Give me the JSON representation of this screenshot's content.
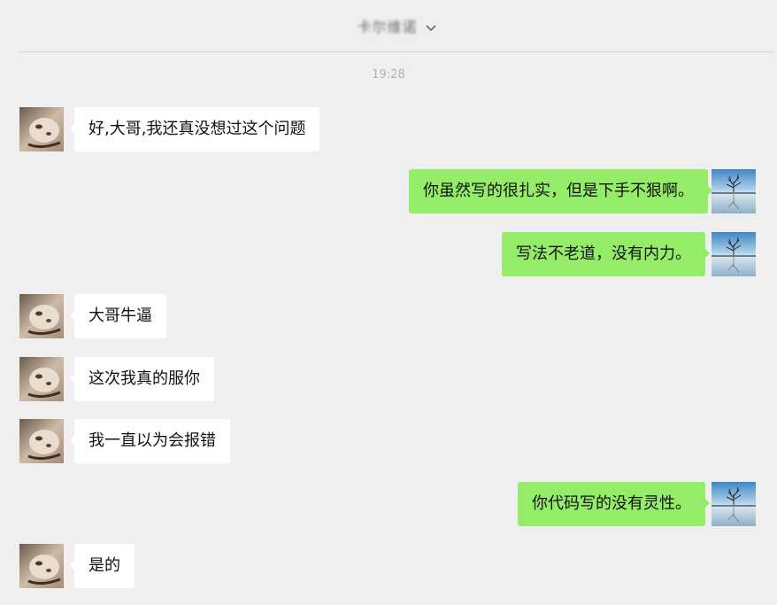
{
  "header": {
    "title": "卡尔维诺"
  },
  "timestamp": "19:28",
  "messages": [
    {
      "side": "left",
      "text": "好,大哥,我还真没想过这个问题"
    },
    {
      "side": "right",
      "text": "你虽然写的很扎实，但是下手不狠啊。"
    },
    {
      "side": "right",
      "text": "写法不老道，没有内力。"
    },
    {
      "side": "left",
      "text": "大哥牛逼"
    },
    {
      "side": "left",
      "text": "这次我真的服你"
    },
    {
      "side": "left",
      "text": "我一直以为会报错"
    },
    {
      "side": "right",
      "text": "你代码写的没有灵性。"
    },
    {
      "side": "left",
      "text": "是的"
    }
  ],
  "colors": {
    "background": "#efefef",
    "self_bubble": "#95ec69",
    "other_bubble": "#ffffff"
  }
}
